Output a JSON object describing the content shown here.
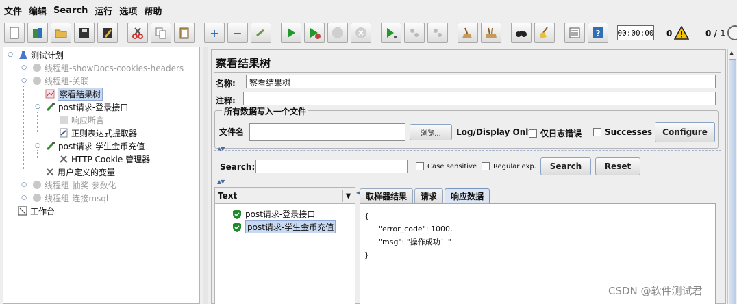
{
  "menu": [
    "文件",
    "编辑",
    "Search",
    "运行",
    "选项",
    "帮助"
  ],
  "toolbar": {
    "timer": "00:00:00",
    "warning_count": "0",
    "thread_count": "0 / 1"
  },
  "tree": {
    "root": "测试计划",
    "items": [
      "线程组-showDocs-cookies-headers",
      "线程组-关联",
      "察看结果树",
      "post请求-登录接口",
      "响应断言",
      "正则表达式提取器",
      "post请求-学生金币充值",
      "HTTP Cookie 管理器",
      "用户定义的变量",
      "线程组-抽奖-参数化",
      "线程组-连接msql",
      "工作台"
    ]
  },
  "panel": {
    "title": "察看结果树",
    "name_label": "名称:",
    "name_value": "察看结果树",
    "comment_label": "注释:",
    "comment_value": "",
    "fieldset_legend": "所有数据写入一个文件",
    "filename_label": "文件名",
    "filename_value": "",
    "browse_label": "浏览...",
    "log_display_label": "Log/Display Only:",
    "errors_only_label": "仅日志错误",
    "successes_label": "Successes",
    "configure_label": "Configure"
  },
  "search": {
    "label": "Search:",
    "value": "",
    "case_sensitive_label": "Case sensitive",
    "regexp_label": "Regular exp.",
    "search_button": "Search",
    "reset_button": "Reset"
  },
  "results": {
    "renderer": "Text",
    "samples": [
      "post请求-登录接口",
      "post请求-学生金币充值"
    ],
    "tabs": [
      "取样器结果",
      "请求",
      "响应数据"
    ],
    "response_text": "{\n      \"error_code\": 1000,\n      \"msg\": \"操作成功！\"\n}"
  },
  "watermark": "CSDN @软件测试君"
}
